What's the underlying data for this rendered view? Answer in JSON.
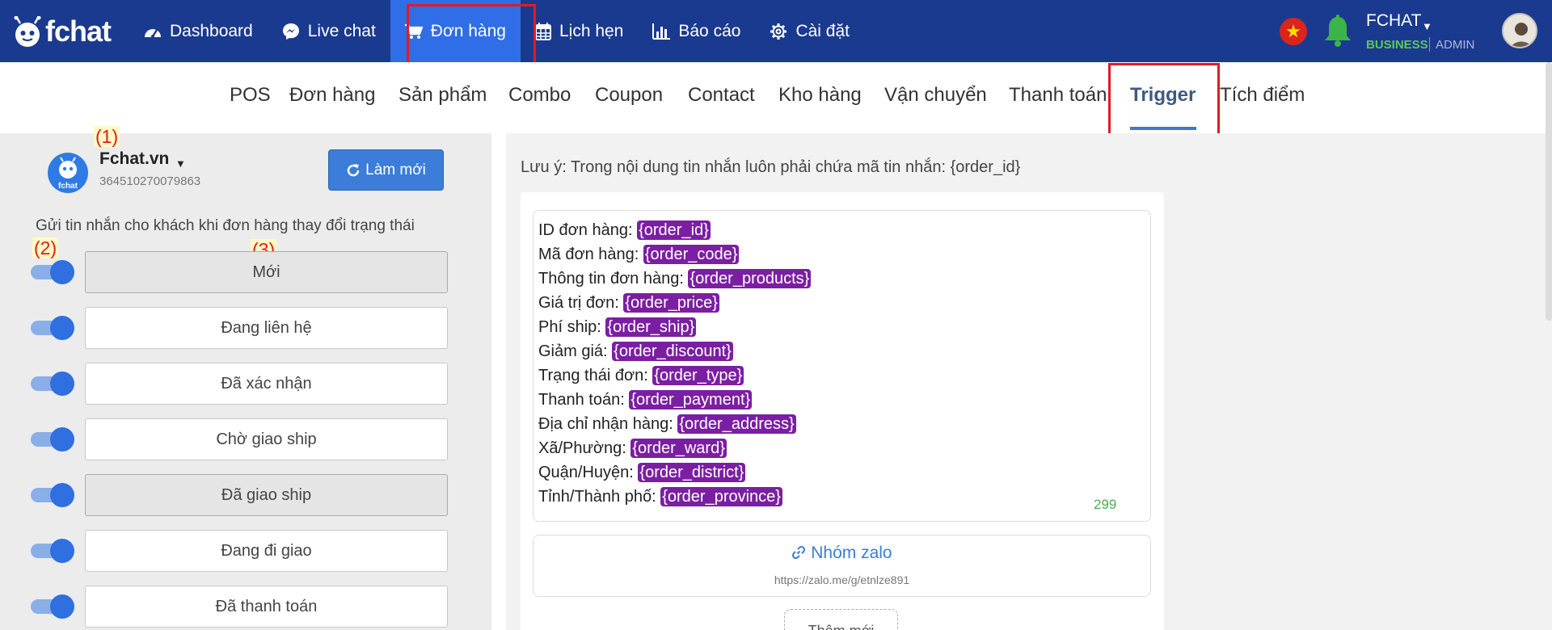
{
  "brand": {
    "name": "fchat"
  },
  "nav": {
    "items": [
      {
        "label": "Dashboard",
        "icon": "dashboard-gauge-icon"
      },
      {
        "label": "Live chat",
        "icon": "messenger-icon"
      },
      {
        "label": "Đơn hàng",
        "icon": "shopping-cart-icon",
        "active": true
      },
      {
        "label": "Lịch hẹn",
        "icon": "calendar-icon"
      },
      {
        "label": "Báo cáo",
        "icon": "bar-chart-icon"
      },
      {
        "label": "Cài đặt",
        "icon": "gear-icon"
      }
    ]
  },
  "account": {
    "name": "FCHAT",
    "plan": "BUSINESS",
    "role": "ADMIN",
    "language_flag": "vietnam-flag-icon"
  },
  "subtabs": {
    "items": [
      "POS",
      "Đơn hàng",
      "Sản phẩm",
      "Combo",
      "Coupon",
      "Contact",
      "Kho hàng",
      "Vận chuyển",
      "Thanh toán",
      "Trigger",
      "Tích điểm"
    ],
    "active": "Trigger"
  },
  "page": {
    "name": "Fchat.vn",
    "id": "364510270079863",
    "logo_text": "fchat"
  },
  "refresh_label": "Làm mới",
  "left_description": "Gửi tin nhắn cho khách khi đơn hàng thay đổi trạng thái",
  "annotations": [
    "(1)",
    "(2)",
    "(3)"
  ],
  "statuses": [
    {
      "label": "Mới",
      "enabled": true,
      "selected": true
    },
    {
      "label": "Đang liên hệ",
      "enabled": true,
      "selected": false
    },
    {
      "label": "Đã xác nhận",
      "enabled": true,
      "selected": false
    },
    {
      "label": "Chờ giao ship",
      "enabled": true,
      "selected": false
    },
    {
      "label": "Đã giao ship",
      "enabled": true,
      "selected": true
    },
    {
      "label": "Đang đi giao",
      "enabled": true,
      "selected": false
    },
    {
      "label": "Đã thanh toán",
      "enabled": true,
      "selected": false
    }
  ],
  "note": "Lưu ý: Trong nội dung tin nhắn luôn phải chứa mã tin nhắn:  {order_id}",
  "message_lines": [
    {
      "label": "ID đơn hàng: ",
      "tag": "{order_id}"
    },
    {
      "label": "Mã đơn hàng: ",
      "tag": "{order_code}"
    },
    {
      "label": "Thông tin đơn hàng: ",
      "tag": "{order_products}"
    },
    {
      "label": "Giá trị đơn: ",
      "tag": "{order_price}"
    },
    {
      "label": "Phí ship: ",
      "tag": "{order_ship}"
    },
    {
      "label": "Giảm giá: ",
      "tag": "{order_discount}"
    },
    {
      "label": "Trạng thái đơn: ",
      "tag": "{order_type}"
    },
    {
      "label": "Thanh toán: ",
      "tag": "{order_payment}"
    },
    {
      "label": "Địa chỉ nhận hàng: ",
      "tag": "{order_address}"
    },
    {
      "label": "Xã/Phường: ",
      "tag": "{order_ward}"
    },
    {
      "label": "Quận/Huyện: ",
      "tag": "{order_district}"
    },
    {
      "label": "Tỉnh/Thành phố: ",
      "tag": "{order_province}"
    }
  ],
  "char_count": "299",
  "zalo": {
    "title": "Nhóm zalo",
    "url": "https://zalo.me/g/etnlze891"
  },
  "add_button_label": "Thêm mới",
  "colors": {
    "topbar": "#1a3a8f",
    "active_nav": "#2f6ee6",
    "tag": "#7b1fa2",
    "highlight_border": "#e01b24"
  }
}
